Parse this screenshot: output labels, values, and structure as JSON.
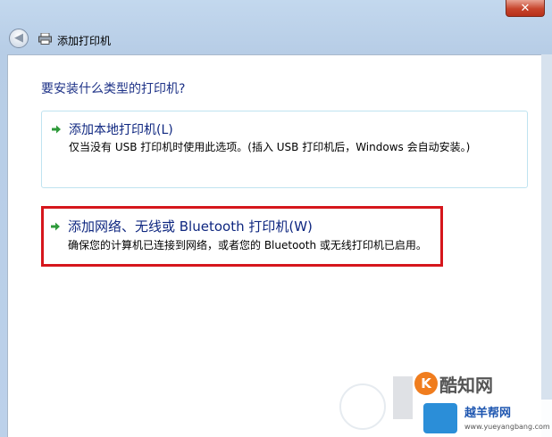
{
  "window": {
    "nav_title": "添加打印机",
    "close_label": "✕"
  },
  "main": {
    "heading": "要安装什么类型的打印机?"
  },
  "options": [
    {
      "title": "添加本地打印机(L)",
      "description": "仅当没有 USB 打印机时使用此选项。(插入 USB 打印机后，Windows 会自动安装。)"
    },
    {
      "title": "添加网络、无线或 Bluetooth 打印机(W)",
      "description": "确保您的计算机已连接到网络，或者您的 Bluetooth 或无线打印机已启用。",
      "highlighted": true
    }
  ],
  "watermarks": {
    "logo1_text": "酷知网",
    "logo1_mark": "K",
    "logo2_text": "越羊帮网",
    "logo2_url": "www.yueyangbang.com"
  },
  "colors": {
    "highlight_border": "#d6161c",
    "link_blue": "#0f2780",
    "arrow_green": "#2e9a3a"
  },
  "icons": [
    "back-arrow-icon",
    "printer-icon",
    "green-arrow-icon",
    "close-icon"
  ]
}
